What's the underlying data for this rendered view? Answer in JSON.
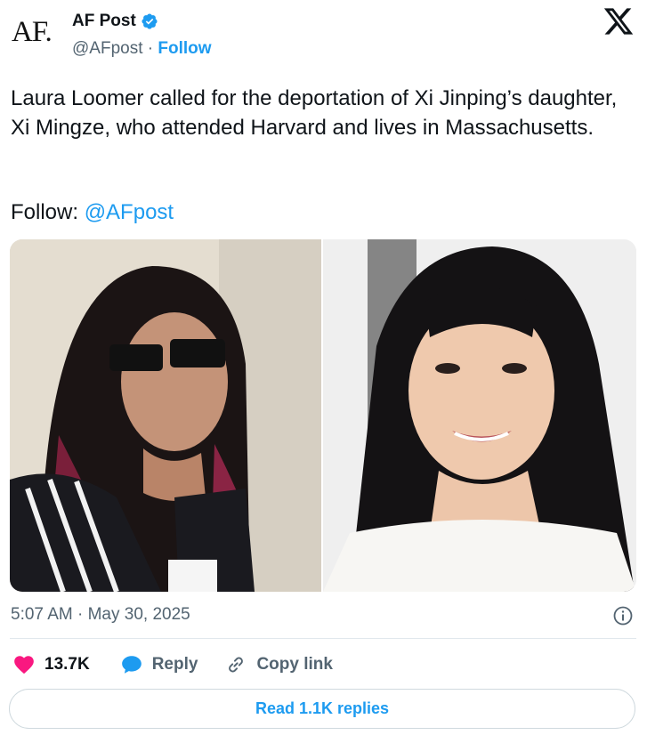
{
  "account": {
    "avatar_text": "AF.",
    "name": "AF Post",
    "handle": "@AFpost",
    "separator": " · ",
    "follow_label": "Follow",
    "verified_icon": "verified-badge-icon",
    "platform_icon": "x-logo-icon"
  },
  "tweet": {
    "text": "Laura Loomer called for the deportation of Xi Jinping’s daughter, Xi Mingze, who attended Harvard and lives in Massachusetts.",
    "follow_prefix": "Follow: ",
    "follow_mention": "@AFpost"
  },
  "media": {
    "images": [
      {
        "name": "woman-with-sunglasses-photo"
      },
      {
        "name": "smiling-young-woman-photo"
      }
    ]
  },
  "meta": {
    "timestamp": "5:07 AM · May 30, 2025",
    "info_icon": "info-icon"
  },
  "actions": {
    "like_count": "13.7K",
    "reply_label": "Reply",
    "copy_label": "Copy link"
  },
  "footer": {
    "read_replies_label": "Read 1.1K replies"
  },
  "colors": {
    "accent": "#1d9bf0",
    "like": "#f91880",
    "text": "#0f1419",
    "muted": "#536471"
  }
}
